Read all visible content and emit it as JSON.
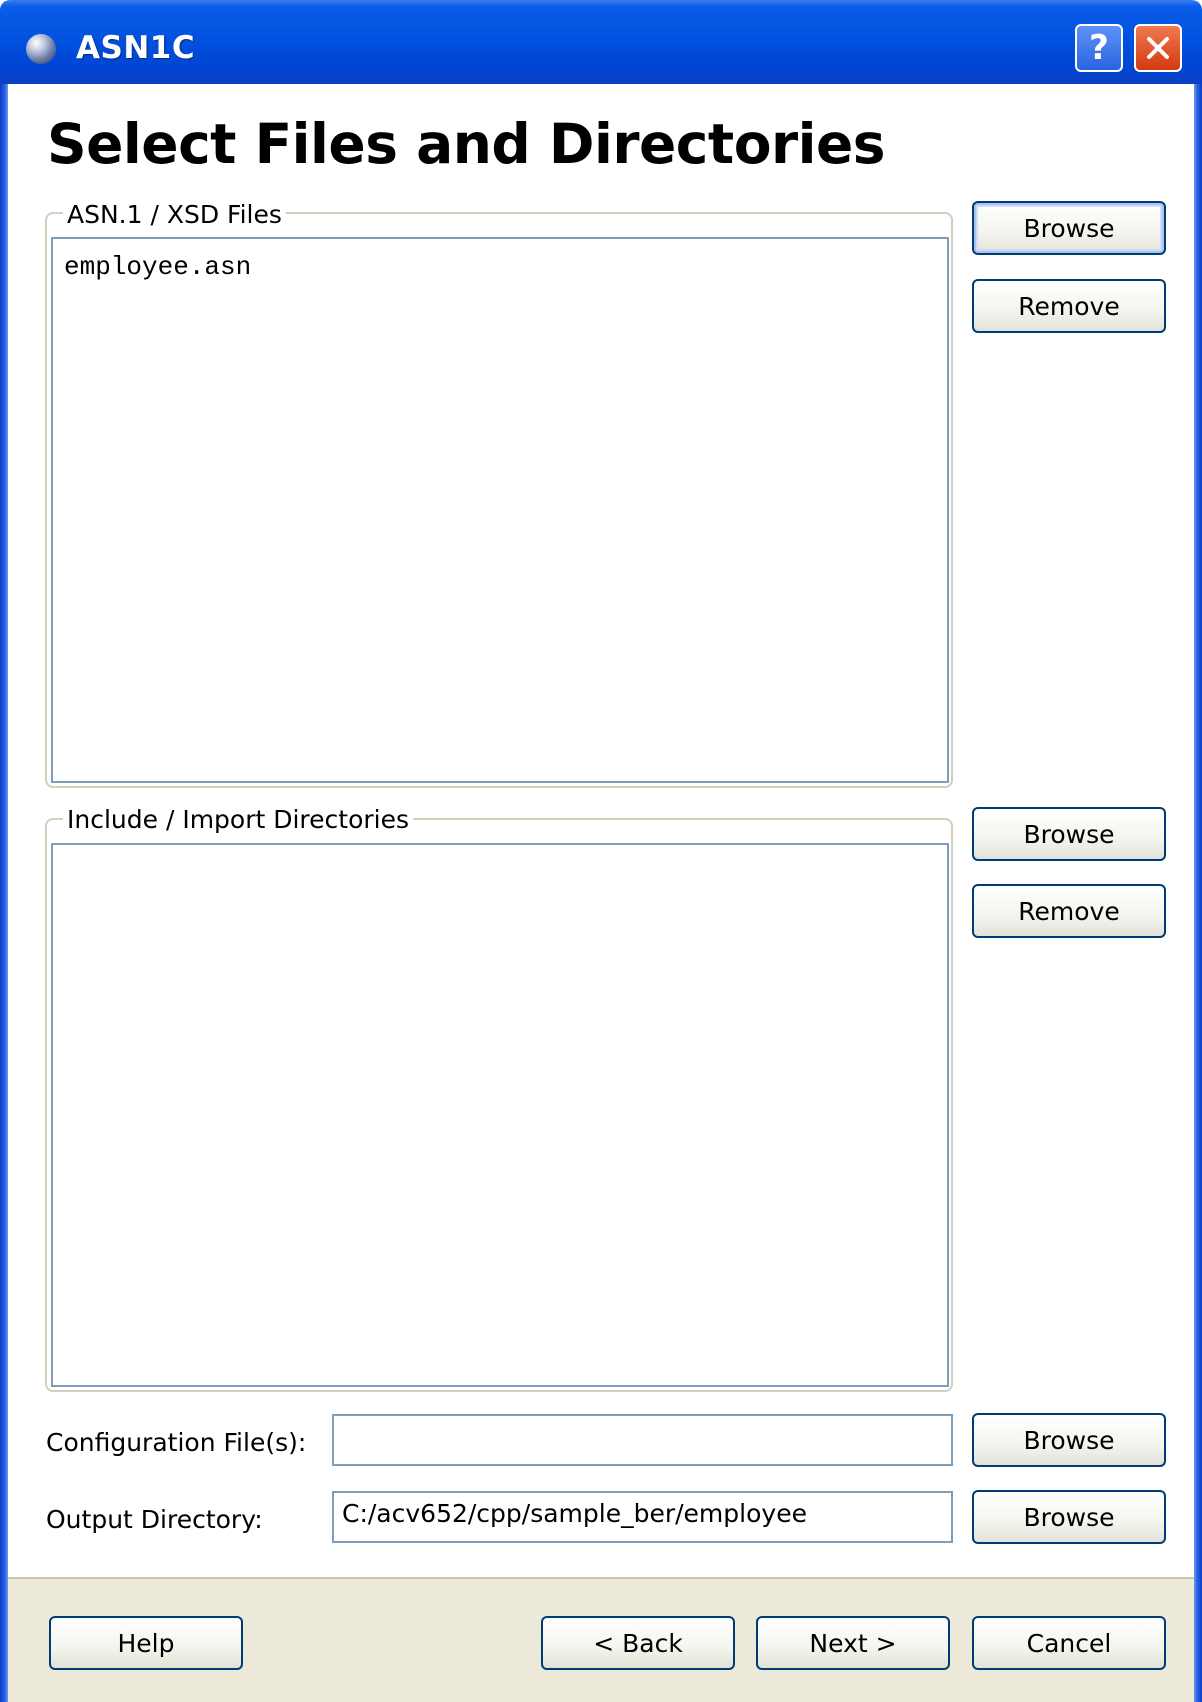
{
  "window": {
    "title": "ASN1C",
    "help_glyph": "?",
    "close_glyph": "✕"
  },
  "page": {
    "title": "Select Files and Directories"
  },
  "asn_files": {
    "legend": "ASN.1 / XSD Files",
    "items": [
      "employee.asn"
    ],
    "browse_label": "Browse",
    "remove_label": "Remove"
  },
  "include_dirs": {
    "legend": "Include / Import Directories",
    "items": [],
    "browse_label": "Browse",
    "remove_label": "Remove"
  },
  "config": {
    "label": "Configuration File(s):",
    "value": "",
    "browse_label": "Browse"
  },
  "output": {
    "label": "Output Directory:",
    "value": "C:/acv652/cpp/sample_ber/employee",
    "browse_label": "Browse"
  },
  "footer": {
    "help_label": "Help",
    "back_label": "< Back",
    "next_label": "Next >",
    "cancel_label": "Cancel"
  },
  "colors": {
    "titlebar": "#0152e0",
    "footer_bg": "#ece9d8",
    "button_border": "#003c74",
    "field_border": "#7f9db9"
  }
}
